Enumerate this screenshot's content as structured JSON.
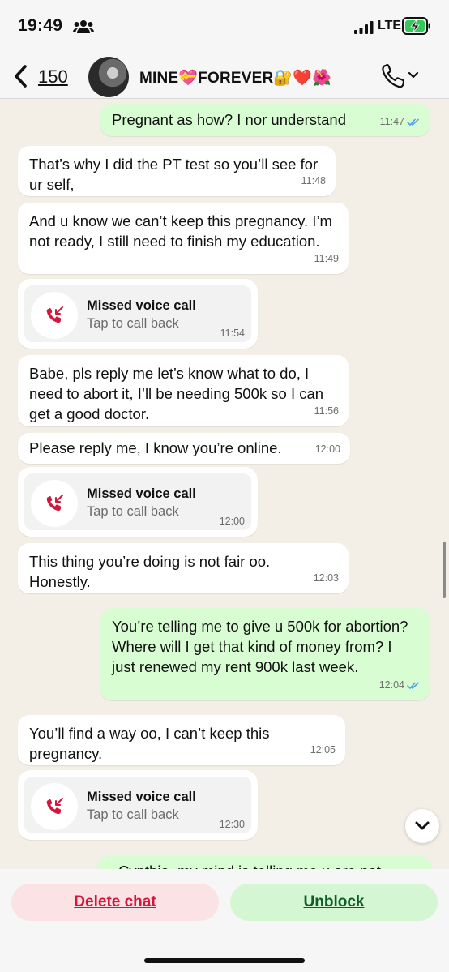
{
  "status": {
    "time": "19:49",
    "network": "LTE"
  },
  "header": {
    "back_count": "150",
    "title": "MINE💝FOREVER🔐❤️🌺"
  },
  "messages": [
    {
      "dir": "out",
      "text": "Pregnant as how? I nor understand",
      "time": "11:47"
    },
    {
      "dir": "in",
      "text": "That’s why I did the PT test so you’ll see for ur self,",
      "time": "11:48"
    },
    {
      "dir": "in",
      "text": "And u know we can’t keep this pregnancy. I’m not ready, I still need to finish my education.",
      "time": "11:49"
    },
    {
      "dir": "in",
      "type": "call",
      "title": "Missed voice call",
      "sub": "Tap to call back",
      "time": "11:54"
    },
    {
      "dir": "in",
      "text": "Babe, pls reply me let’s know what to do, I need to abort it, I’ll be needing 500k so I can get a good doctor.",
      "time": "11:56"
    },
    {
      "dir": "in",
      "text": "Please reply me, I know you’re online.",
      "time": "12:00"
    },
    {
      "dir": "in",
      "type": "call",
      "title": "Missed voice call",
      "sub": "Tap to call back",
      "time": "12:00"
    },
    {
      "dir": "in",
      "text": "This thing you’re doing is not fair oo. Honestly.",
      "time": "12:03"
    },
    {
      "dir": "out",
      "text": "You’re telling me to give u 500k for abortion? Where will I get that kind of money from? I just renewed my rent 900k last week.",
      "time": "12:04"
    },
    {
      "dir": "in",
      "text": "You’ll find a way oo, I can’t keep this pregnancy.",
      "time": "12:05"
    },
    {
      "dir": "in",
      "type": "call",
      "title": "Missed voice call",
      "sub": "Tap to call back",
      "time": "12:30"
    },
    {
      "dir": "out",
      "text": "Cynthia, my mind is telling me u are not",
      "time": ""
    }
  ],
  "actions": {
    "delete": "Delete chat",
    "unblock": "Unblock"
  },
  "colors": {
    "delete_text": "#d4163c",
    "unblock_text": "#0e5e2a",
    "outgoing_bubble": "#d9fdd3",
    "read_ticks": "#4fa3e8"
  }
}
